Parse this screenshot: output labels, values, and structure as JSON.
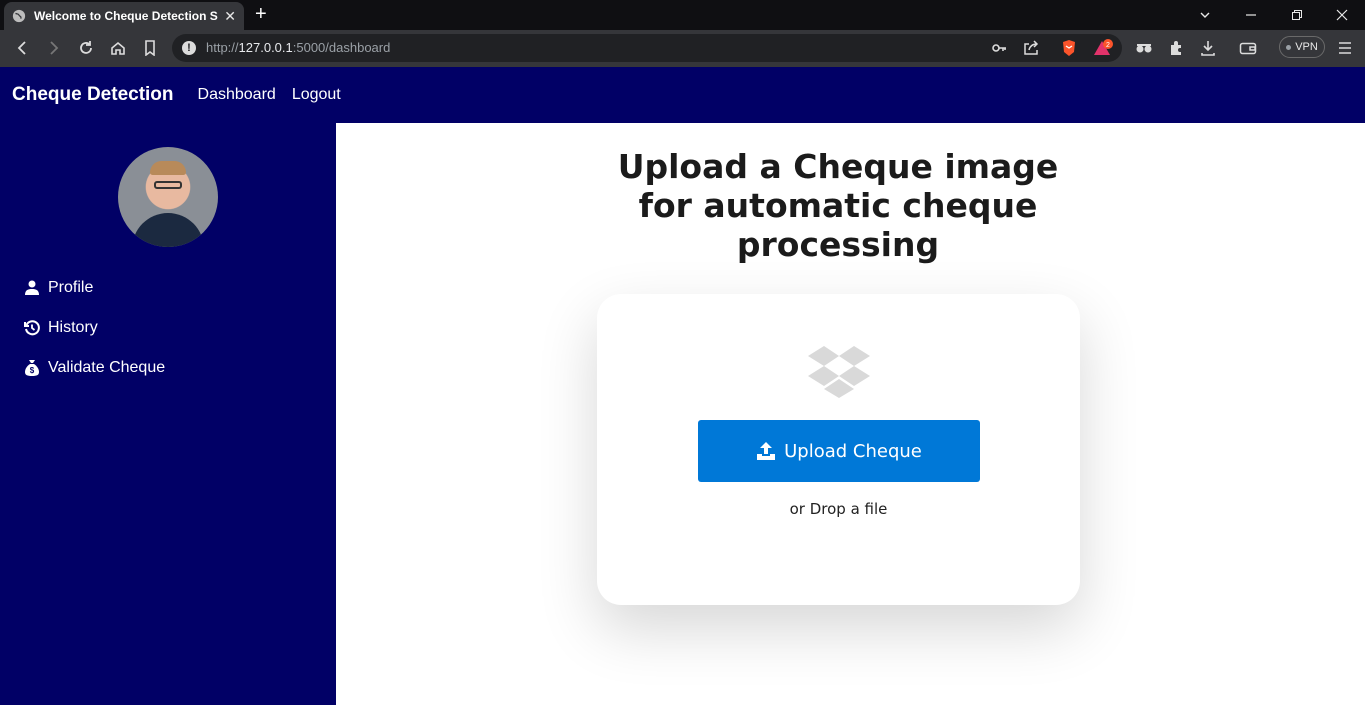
{
  "browser": {
    "tab_title": "Welcome to Cheque Detection Sy",
    "url_prefix": "http://",
    "url_host": "127.0.0.1",
    "url_rest": ":5000/dashboard",
    "vpn_label": "VPN",
    "notification_count": "2"
  },
  "navbar": {
    "brand": "Cheque Detection",
    "links": [
      "Dashboard",
      "Logout"
    ]
  },
  "sidebar": {
    "items": [
      {
        "label": "Profile",
        "icon": "user-icon"
      },
      {
        "label": "History",
        "icon": "history-icon"
      },
      {
        "label": "Validate Cheque",
        "icon": "money-bag-icon"
      }
    ]
  },
  "main": {
    "title": "Upload a Cheque image for automatic cheque processing",
    "upload_label": "Upload Cheque",
    "drop_text": "or Drop a file"
  },
  "colors": {
    "nav_bg": "#010066",
    "button_bg": "#0078d7"
  }
}
